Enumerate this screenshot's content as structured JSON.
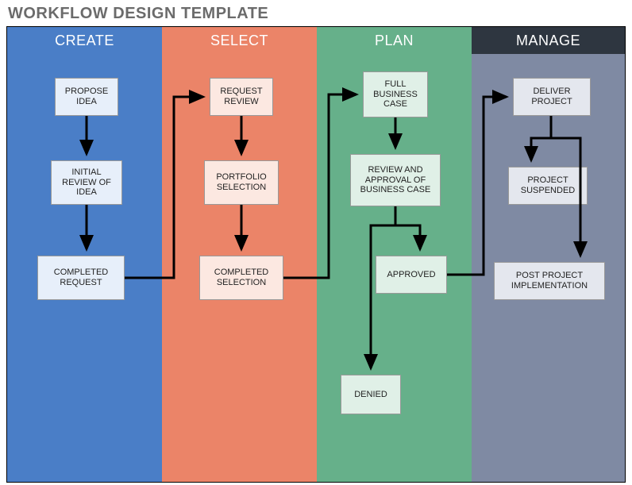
{
  "title": "WORKFLOW DESIGN TEMPLATE",
  "columns": {
    "create": {
      "header": "CREATE",
      "boxes": [
        "PROPOSE IDEA",
        "INITIAL REVIEW OF IDEA",
        "COMPLETED REQUEST"
      ]
    },
    "select": {
      "header": "SELECT",
      "boxes": [
        "REQUEST REVIEW",
        "PORTFOLIO SELECTION",
        "COMPLETED SELECTION"
      ]
    },
    "plan": {
      "header": "PLAN",
      "boxes": [
        "FULL BUSINESS CASE",
        "REVIEW AND APPROVAL OF BUSINESS CASE",
        "APPROVED",
        "DENIED"
      ]
    },
    "manage": {
      "header": "MANAGE",
      "boxes": [
        "DELIVER PROJECT",
        "PROJECT SUSPENDED",
        "POST PROJECT IMPLEMENTATION"
      ]
    }
  }
}
